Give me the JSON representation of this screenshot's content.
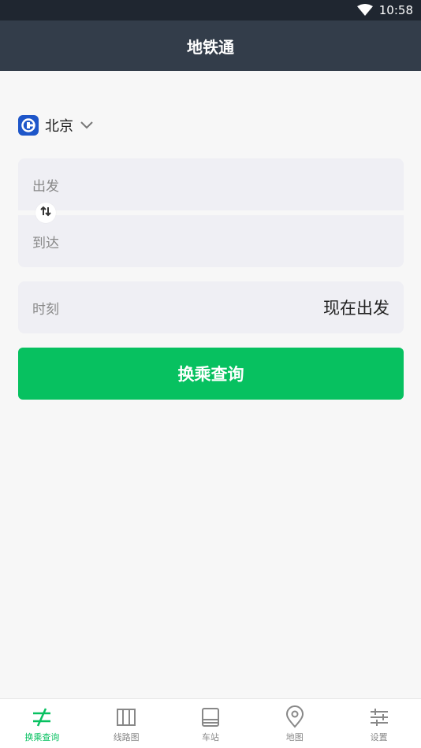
{
  "status_bar": {
    "time": "10:58"
  },
  "app_bar": {
    "title": "地铁通"
  },
  "city": {
    "name": "北京"
  },
  "route": {
    "from_placeholder": "出发",
    "to_placeholder": "到达"
  },
  "time": {
    "label": "时刻",
    "value": "现在出发"
  },
  "search": {
    "label": "换乘查询"
  },
  "tabs": [
    {
      "label": "换乘查询",
      "icon": "transfer-icon",
      "active": true
    },
    {
      "label": "线路图",
      "icon": "map-book-icon",
      "active": false
    },
    {
      "label": "车站",
      "icon": "station-icon",
      "active": false
    },
    {
      "label": "地图",
      "icon": "location-pin-icon",
      "active": false
    },
    {
      "label": "设置",
      "icon": "sliders-icon",
      "active": false
    }
  ],
  "colors": {
    "accent": "#07c160",
    "app_bar": "#333d4a",
    "status_bar": "#1f2630",
    "field_bg": "#efeff4",
    "logo": "#1e56c9"
  }
}
